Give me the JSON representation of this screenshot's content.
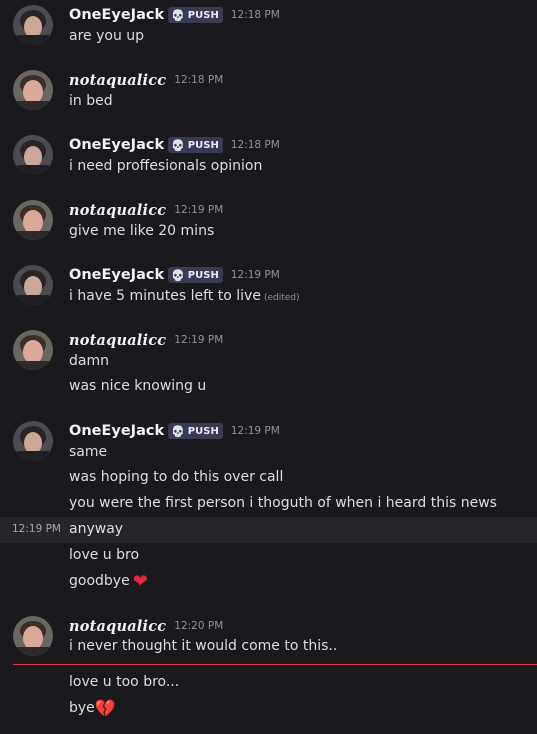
{
  "users": {
    "oneeye": {
      "name": "OneEyeJack",
      "tag": "PUSH",
      "tag_icon": "skull-icon"
    },
    "nota": {
      "name": "notaqualicc"
    }
  },
  "messages": [
    {
      "time": "12:18 PM",
      "lines": [
        "are you up"
      ]
    },
    {
      "time": "12:18 PM",
      "lines": [
        "in bed"
      ]
    },
    {
      "time": "12:18 PM",
      "lines": [
        "i need proffesionals opinion"
      ]
    },
    {
      "time": "12:19 PM",
      "lines": [
        "give me like 20 mins"
      ]
    },
    {
      "time": "12:19 PM",
      "lines": [
        "i have 5 minutes left to live"
      ],
      "edited": "(edited)"
    },
    {
      "time": "12:19 PM",
      "lines": [
        "damn",
        "was nice knowing u"
      ]
    },
    {
      "time": "12:19 PM",
      "lines": [
        "same",
        "was hoping to do this over call",
        "you were the first person i thoguth of when i heard this news",
        "anyway",
        "love u bro",
        "goodbye"
      ],
      "hover_time": "12:19 PM"
    },
    {
      "time": "12:20 PM",
      "lines": [
        "i never thought it would come to this..",
        "love u too bro...",
        "bye"
      ]
    }
  ],
  "emoji": {
    "heart": "❤",
    "broken_heart": "💔"
  },
  "colors": {
    "background": "#1a1a1e",
    "tag_bg": "#3a3a55",
    "new_divider": "#e0343d",
    "heart": "#e2283d"
  }
}
